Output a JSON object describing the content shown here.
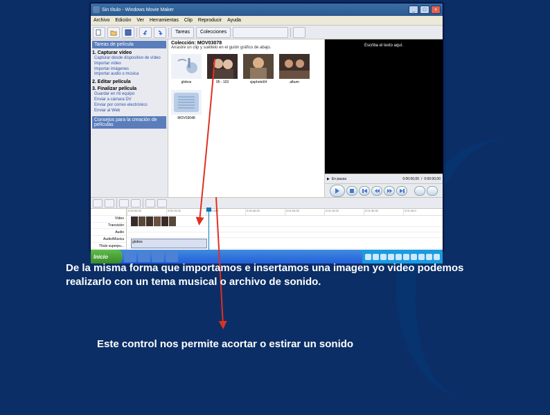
{
  "window": {
    "title": "Sin título - Windows Movie Maker",
    "btn_min": "_",
    "btn_max": "□",
    "btn_close": "×"
  },
  "menu": [
    "Archivo",
    "Edición",
    "Ver",
    "Herramientas",
    "Clip",
    "Reproducir",
    "Ayuda"
  ],
  "toolbar": {
    "tasks_label": "Tareas",
    "collections_label": "Colecciones"
  },
  "tasks": {
    "header": "Tareas de película",
    "step1": "1. Capturar vídeo",
    "step1_items": [
      "Capturar desde dispositivo de vídeo",
      "Importar vídeo",
      "Importar imágenes",
      "Importar audio o música"
    ],
    "step2": "2. Editar película",
    "step3": "3. Finalizar película",
    "step3_items": [
      "Guardar en mi equipo",
      "Enviar a cámara DV",
      "Enviar por correo electrónico",
      "Enviar al Web"
    ],
    "tips_header": "Consejos para la creación de películas"
  },
  "collection": {
    "title": "Colección: MOV03078",
    "subtitle": "Arrastre un clip y suéltelo en el guión gráfico de abajo.",
    "thumbs": [
      {
        "name": "globos"
      },
      {
        "name": "05 - 103"
      },
      {
        "name": "vjaphoto04"
      },
      {
        "name": "album"
      },
      {
        "name": "MOV03048"
      }
    ]
  },
  "preview": {
    "placeholder": "Escriba el texto aquí.",
    "elapsed": "0:00:00,00",
    "total": "0:00:00,00",
    "info_label": "En pausa"
  },
  "timeline": {
    "ruler": [
      "0:00:00,00",
      "0:00:15,00",
      "0:00:34,0",
      "0:00:45,00",
      "0:01:00,00",
      "0:01:15,00",
      "0:01:30,00",
      "0:01:45,0"
    ],
    "tracks": [
      "Vídeo",
      "Transición",
      "Audio",
      "Audio/Música",
      "Título superpu..."
    ],
    "audio_clip": "globos"
  },
  "taskbar": {
    "start": "Inicio"
  },
  "annotations": {
    "a1": "De la misma forma que importamos e insertamos una imagen yo video podemos realizarlo con un tema musical o archivo de sonido.",
    "a2": "Este control nos permite acortar o estirar un sonido"
  }
}
